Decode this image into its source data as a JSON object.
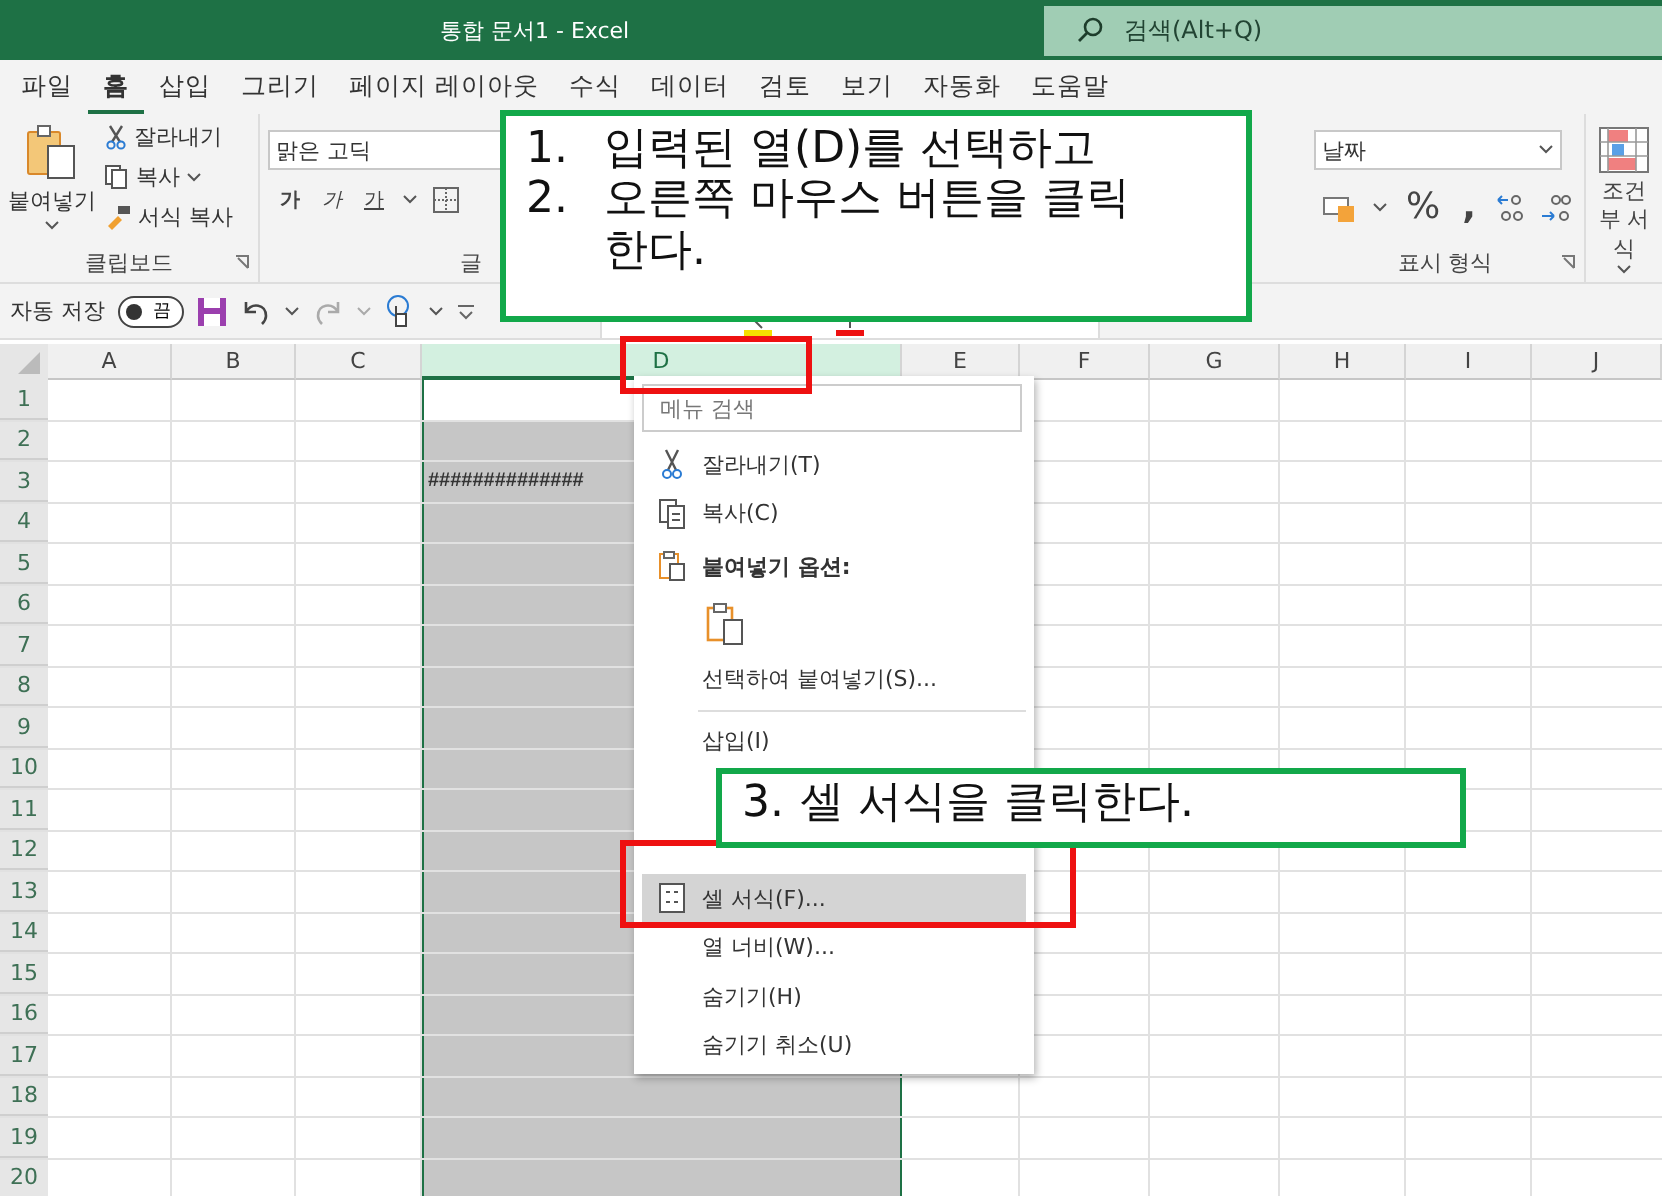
{
  "window": {
    "title": "통합 문서1  -  Excel"
  },
  "search": {
    "placeholder": "검색(Alt+Q)"
  },
  "tabs": [
    {
      "label": "파일",
      "selected": false
    },
    {
      "label": "홈",
      "selected": true
    },
    {
      "label": "삽입",
      "selected": false
    },
    {
      "label": "그리기",
      "selected": false
    },
    {
      "label": "페이지 레이아웃",
      "selected": false
    },
    {
      "label": "수식",
      "selected": false
    },
    {
      "label": "데이터",
      "selected": false
    },
    {
      "label": "검토",
      "selected": false
    },
    {
      "label": "보기",
      "selected": false
    },
    {
      "label": "자동화",
      "selected": false
    },
    {
      "label": "도움말",
      "selected": false
    }
  ],
  "ribbon": {
    "clipboard": {
      "paste": "붙여넣기",
      "cut": "잘라내기",
      "copy": "복사",
      "format_painter": "서식 복사",
      "label": "클립보드"
    },
    "font": {
      "name": "맑은 고딕",
      "bold": "가",
      "italic": "가",
      "underline": "가",
      "label": "글"
    },
    "number": {
      "format": "날짜",
      "percent": "%",
      "comma": ",",
      "label": "표시 형식"
    },
    "styles": {
      "conditional": "조건부 서식"
    }
  },
  "quick_access": {
    "autosave_label": "자동 저장",
    "autosave_on": false,
    "toggle_text": "끔"
  },
  "sheet": {
    "columns": [
      {
        "label": "A",
        "selected": false
      },
      {
        "label": "B",
        "selected": false
      },
      {
        "label": "C",
        "selected": false
      },
      {
        "label": "D",
        "selected": true
      },
      {
        "label": "E",
        "selected": false
      },
      {
        "label": "F",
        "selected": false
      },
      {
        "label": "G",
        "selected": false
      },
      {
        "label": "H",
        "selected": false
      },
      {
        "label": "I",
        "selected": false
      },
      {
        "label": "J",
        "selected": false
      }
    ],
    "rows": [
      {
        "label": "1",
        "active": true
      },
      {
        "label": "2",
        "active": false
      },
      {
        "label": "3",
        "active": false,
        "cells": [
          {},
          {},
          {},
          {
            "text": "##############"
          }
        ]
      },
      {
        "label": "4",
        "active": false
      },
      {
        "label": "5",
        "active": false
      },
      {
        "label": "6",
        "active": false
      },
      {
        "label": "7",
        "active": false
      },
      {
        "label": "8",
        "active": false
      },
      {
        "label": "9",
        "active": false
      },
      {
        "label": "10",
        "active": false
      },
      {
        "label": "11",
        "active": false
      },
      {
        "label": "12",
        "active": false
      },
      {
        "label": "13",
        "active": false
      },
      {
        "label": "14",
        "active": false
      },
      {
        "label": "15",
        "active": false
      },
      {
        "label": "16",
        "active": false
      },
      {
        "label": "17",
        "active": false
      },
      {
        "label": "18",
        "active": false
      },
      {
        "label": "19",
        "active": false
      },
      {
        "label": "20",
        "active": false
      }
    ]
  },
  "context_menu": {
    "search_placeholder": "메뉴 검색",
    "items": [
      {
        "kind": "command",
        "label": "잘라내기(T)",
        "highlighted": false
      },
      {
        "kind": "command",
        "label": "복사(C)",
        "highlighted": false
      },
      {
        "kind": "heading",
        "label": "붙여넣기 옵션:"
      },
      {
        "kind": "paste-option"
      },
      {
        "kind": "command",
        "label": "선택하여 붙여넣기(S)...",
        "highlighted": false
      },
      {
        "kind": "separator"
      },
      {
        "kind": "command",
        "label": "삽입(I)",
        "highlighted": false
      },
      {
        "kind": "covered"
      },
      {
        "kind": "covered"
      },
      {
        "kind": "command",
        "label": "셀 서식(F)...",
        "highlighted": true
      },
      {
        "kind": "command",
        "label": "열 너비(W)...",
        "highlighted": false
      },
      {
        "kind": "command",
        "label": "숨기기(H)",
        "highlighted": false
      },
      {
        "kind": "command",
        "label": "숨기기 취소(U)",
        "highlighted": false
      }
    ]
  },
  "annotations": [
    {
      "steps": [
        {
          "number": "1.",
          "text": "입력된 열(D)를 선택하고"
        },
        {
          "number": "2.",
          "text": "오른쪽 마우스 버튼을 클릭 한다."
        }
      ]
    },
    {
      "steps": [
        {
          "number": "3.",
          "text": "셀 서식을 클릭한다."
        }
      ]
    }
  ]
}
